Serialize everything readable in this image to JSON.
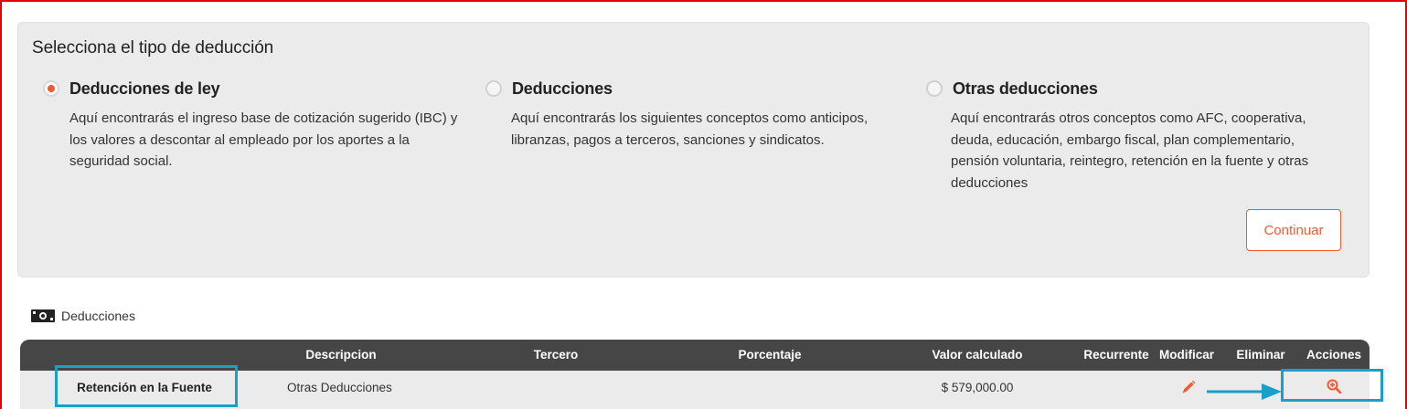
{
  "form": {
    "title": "Selecciona el tipo de deducción",
    "options": [
      {
        "label": "Deducciones de ley",
        "checked": true,
        "description": "Aquí encontrarás el ingreso base de cotización sugerido (IBC) y los valores a descontar al empleado por los aportes a la seguridad social."
      },
      {
        "label": "Deducciones",
        "checked": false,
        "description": "Aquí encontrarás los siguientes conceptos como anticipos, libranzas, pagos a terceros, sanciones y sindicatos."
      },
      {
        "label": "Otras deducciones",
        "checked": false,
        "description": "Aquí encontrarás otros conceptos como AFC, cooperativa, deuda, educación, embargo fiscal, plan complementario, pensión voluntaria, reintegro, retención en la fuente y otras deducciones"
      }
    ],
    "continue_label": "Continuar"
  },
  "deductions": {
    "section_title": "Deducciones",
    "section_icon": "money-bill-icon",
    "columns": [
      "",
      "Descripcion",
      "Tercero",
      "Porcentaje",
      "Valor calculado",
      "Recurrente",
      "Modificar",
      "Eliminar",
      "Acciones"
    ],
    "rows": [
      {
        "name": "Retención en la Fuente",
        "description": "Otras Deducciones",
        "third_party": "",
        "percentage": "",
        "value": "$ 579,000.00",
        "edit_icon": "pencil-icon",
        "action_icon": "zoom-in-icon"
      }
    ]
  },
  "colors": {
    "accent": "#f15a31",
    "header_bg": "#464646",
    "highlight": "#1a9fc8",
    "frame": "#e60000"
  }
}
